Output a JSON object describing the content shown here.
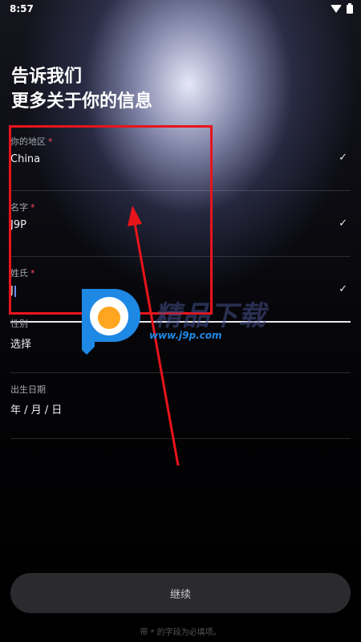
{
  "status_bar": {
    "time": "8:57"
  },
  "header": {
    "line1": "告诉我们",
    "line2": "更多关于你的信息"
  },
  "form": {
    "region": {
      "label": "你的地区",
      "required_mark": "*",
      "value": "China"
    },
    "first_name": {
      "label": "名字",
      "required_mark": "*",
      "value": "J9P"
    },
    "last_name": {
      "label": "姓氏",
      "required_mark": "*",
      "value": "J"
    },
    "gender": {
      "label": "性别",
      "value": "选择"
    },
    "birthday": {
      "label": "出生日期",
      "value": "年 / 月 / 日"
    }
  },
  "check_glyph": "✓",
  "continue_label": "继续",
  "footer_note": "带 * 的字段为必填项。",
  "watermark": {
    "text": "精品下载",
    "url": "www.j9p.com"
  },
  "colors": {
    "required": "#ff4a5a",
    "annotation": "#e8141c",
    "watermark_blue": "#1e88e5",
    "watermark_orange": "#ffa51f"
  }
}
